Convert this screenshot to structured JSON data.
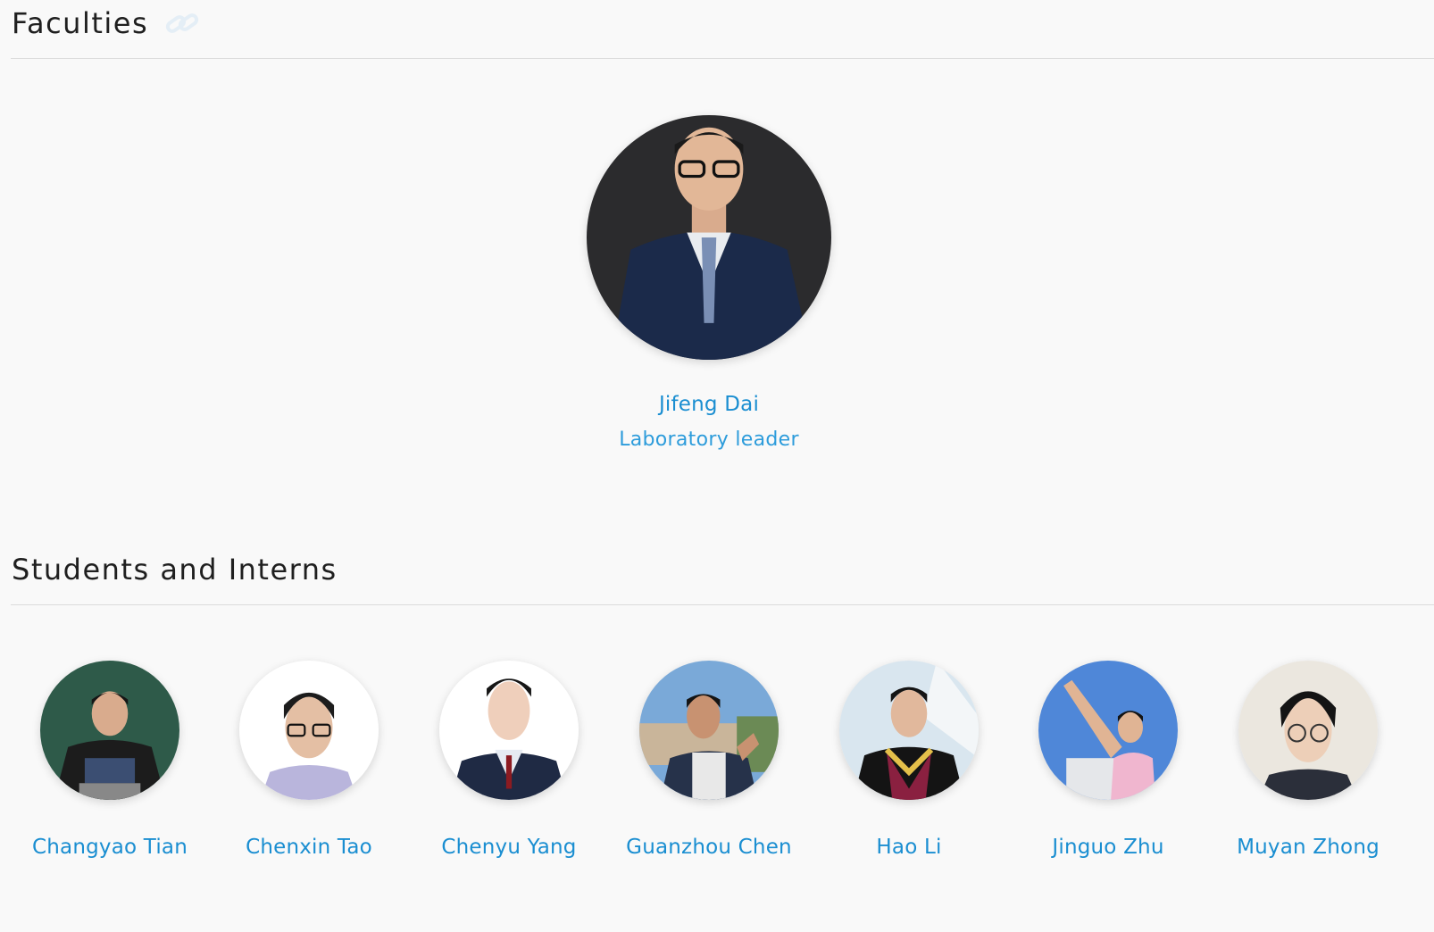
{
  "sections": {
    "faculties_title": "Faculties",
    "students_title": "Students and Interns"
  },
  "faculty": {
    "name": "Jifeng Dai",
    "role": "Laboratory leader"
  },
  "students": [
    {
      "name": "Changyao Tian"
    },
    {
      "name": "Chenxin Tao"
    },
    {
      "name": "Chenyu Yang"
    },
    {
      "name": "Guanzhou Chen"
    },
    {
      "name": "Hao Li"
    },
    {
      "name": "Jinguo Zhu"
    },
    {
      "name": "Muyan Zhong"
    }
  ],
  "colors": {
    "link": "#1a8ed1",
    "background": "#f9f9f9",
    "divider": "#dcdcdc"
  }
}
